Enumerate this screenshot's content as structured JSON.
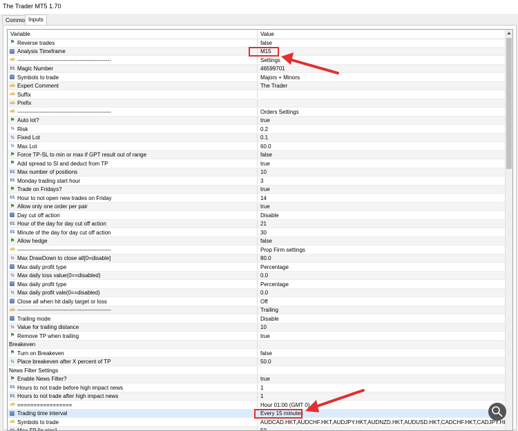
{
  "window": {
    "title": "The Trader MT5 1.70"
  },
  "tabs": [
    {
      "label": "Common",
      "active": false
    },
    {
      "label": "Inputs",
      "active": true
    }
  ],
  "grid": {
    "columns": {
      "variable": "Variable",
      "value": "Value"
    },
    "rows": [
      {
        "icon": "flag",
        "name": "Reverse trades",
        "value": "false"
      },
      {
        "icon": "enum",
        "name": "Analysis Timeframe",
        "value": "M15"
      },
      {
        "icon": "ab",
        "name": "---------------------------------------------------",
        "value": "Settings"
      },
      {
        "icon": "01",
        "name": "Magic Number",
        "value": "46599701"
      },
      {
        "icon": "enum",
        "name": "Symbols to trade",
        "value": "Majors + Minors"
      },
      {
        "icon": "ab",
        "name": "Expert Comment",
        "value": "The Trader"
      },
      {
        "icon": "ab",
        "name": "Suffix",
        "value": ""
      },
      {
        "icon": "ab",
        "name": "Prefix",
        "value": ""
      },
      {
        "icon": "ab",
        "name": "---------------------------------------------------",
        "value": "Orders Settings"
      },
      {
        "icon": "flag",
        "name": "Auto lot?",
        "value": "true"
      },
      {
        "icon": "frac",
        "name": "Risk",
        "value": "0.2"
      },
      {
        "icon": "frac",
        "name": "Fixed Lot",
        "value": "0.1"
      },
      {
        "icon": "frac",
        "name": "Max Lot",
        "value": "60.0"
      },
      {
        "icon": "flag",
        "name": "Force TP-SL to min or max if GPT result out of range",
        "value": "false"
      },
      {
        "icon": "flag",
        "name": "Add spread to Sl and deduct from TP",
        "value": "true"
      },
      {
        "icon": "01",
        "name": "Max number of positions",
        "value": "10"
      },
      {
        "icon": "01",
        "name": "Monday trading start hour",
        "value": "3"
      },
      {
        "icon": "flag",
        "name": "Trade on Fridays?",
        "value": "true"
      },
      {
        "icon": "01",
        "name": "Hour to not open new trades on Friday",
        "value": "14"
      },
      {
        "icon": "flag",
        "name": "Allow only one order per pair",
        "value": "true"
      },
      {
        "icon": "enum",
        "name": "Day cut off action",
        "value": "Disable"
      },
      {
        "icon": "01",
        "name": "Hour of the day for day cut off action",
        "value": "21"
      },
      {
        "icon": "01",
        "name": "Minute of the day for day cut off action",
        "value": "30"
      },
      {
        "icon": "flag",
        "name": "Allow hedge",
        "value": "false"
      },
      {
        "icon": "ab",
        "name": "---------------------------------------------------",
        "value": "Prop Firm settings"
      },
      {
        "icon": "frac",
        "name": "Max DrawDown to close all[0=disable]",
        "value": "80.0"
      },
      {
        "icon": "enum",
        "name": "Max daily profit type",
        "value": "Percentage"
      },
      {
        "icon": "frac",
        "name": "Max daily loss value(0==disabled)",
        "value": "0.0"
      },
      {
        "icon": "enum",
        "name": "Max daily profit type",
        "value": "Percentage"
      },
      {
        "icon": "frac",
        "name": "Max daily profit vale(0==disabled)",
        "value": "0.0"
      },
      {
        "icon": "enum",
        "name": "Close all when hit daily target or loss",
        "value": "Off"
      },
      {
        "icon": "ab",
        "name": "---------------------------------------------------",
        "value": "Trailing"
      },
      {
        "icon": "enum",
        "name": "Trailing mode",
        "value": "Disable"
      },
      {
        "icon": "frac",
        "name": "Value for trailing distance",
        "value": "10"
      },
      {
        "icon": "flag",
        "name": "Remove TP when trailing",
        "value": "true"
      },
      {
        "icon": "none",
        "name": "Breakeven",
        "value": ""
      },
      {
        "icon": "flag",
        "name": "Turn on Breakeven",
        "value": "false"
      },
      {
        "icon": "frac",
        "name": "Place breakeven after X percent of TP",
        "value": "50.0"
      },
      {
        "icon": "none",
        "name": "News Filter Settings",
        "value": ""
      },
      {
        "icon": "flag",
        "name": "Enable News Filter?",
        "value": "true"
      },
      {
        "icon": "01",
        "name": "Hours to not trade before high impact news",
        "value": "1"
      },
      {
        "icon": "01",
        "name": "Hours to not trade after high impact news",
        "value": "1"
      },
      {
        "icon": "ab",
        "name": "=================",
        "value": "Hour 01:00 (GMT 0)"
      },
      {
        "icon": "enum",
        "name": "Trading time interval",
        "value": "Every 15 minutes",
        "selected": true
      },
      {
        "icon": "ab",
        "name": "Symbols to trade",
        "value": "AUDCAD.HKT,AUDCHF.HKT,AUDJPY.HKT,AUDNZD.HKT,AUDUSD.HKT,CADCHF.HKT,CADJPY.HKT,CHFJPY.HKT,EURA..."
      },
      {
        "icon": "01",
        "name": "Max TP [in pips]",
        "value": "50"
      }
    ]
  },
  "colors": {
    "annotation": "#e03030",
    "selection": "#dcebfc",
    "flag_icon": "#2e8b2e",
    "text_icon": "#c9a227",
    "number_icon": "#2d5fa0"
  }
}
